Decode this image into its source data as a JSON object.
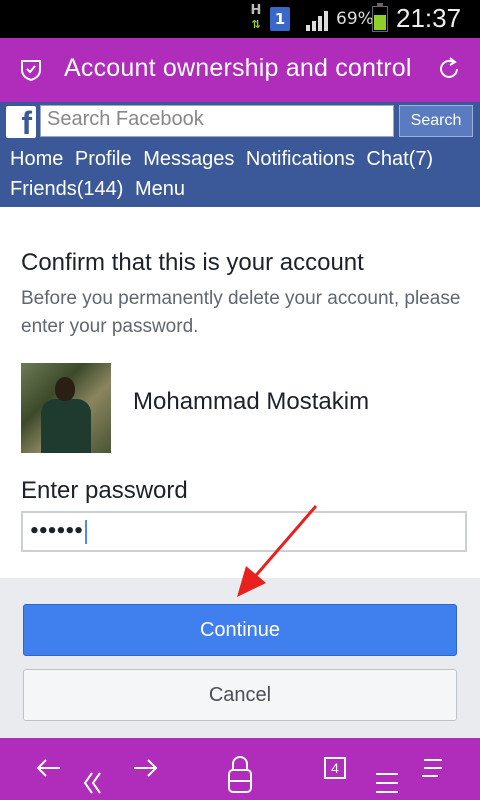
{
  "status_bar": {
    "network_type": "H",
    "sim_slot": "1",
    "battery_percent": "69%",
    "battery_level": 0.69,
    "time": "21:37"
  },
  "browser": {
    "page_title": "Account ownership and control",
    "icons": [
      "shield-icon",
      "reload-icon",
      "back-icon",
      "rewind-icon",
      "forward-icon",
      "lock-icon",
      "tabs-icon",
      "stack-icon",
      "menu-icon"
    ],
    "tabs_count": "4",
    "accent_color": "#b02cbb"
  },
  "facebook_header": {
    "logo": "f",
    "search_placeholder": "Search Facebook",
    "search_button": "Search",
    "nav": {
      "home": "Home",
      "profile": "Profile",
      "messages": "Messages",
      "notifications": "Notifications",
      "chat": "Chat(7)",
      "friends": "Friends(144)",
      "menu": "Menu"
    },
    "brand_color": "#3b5998"
  },
  "confirm": {
    "heading": "Confirm that this is your account",
    "description": "Before you permanently delete your account, please enter your password.",
    "user_name": "Mohammad Mostakim",
    "password_label": "Enter password",
    "password_value": "••••••"
  },
  "actions": {
    "continue": "Continue",
    "cancel": "Cancel",
    "continue_color": "#4080ee",
    "annotation_arrow_color": "#e8201e"
  }
}
